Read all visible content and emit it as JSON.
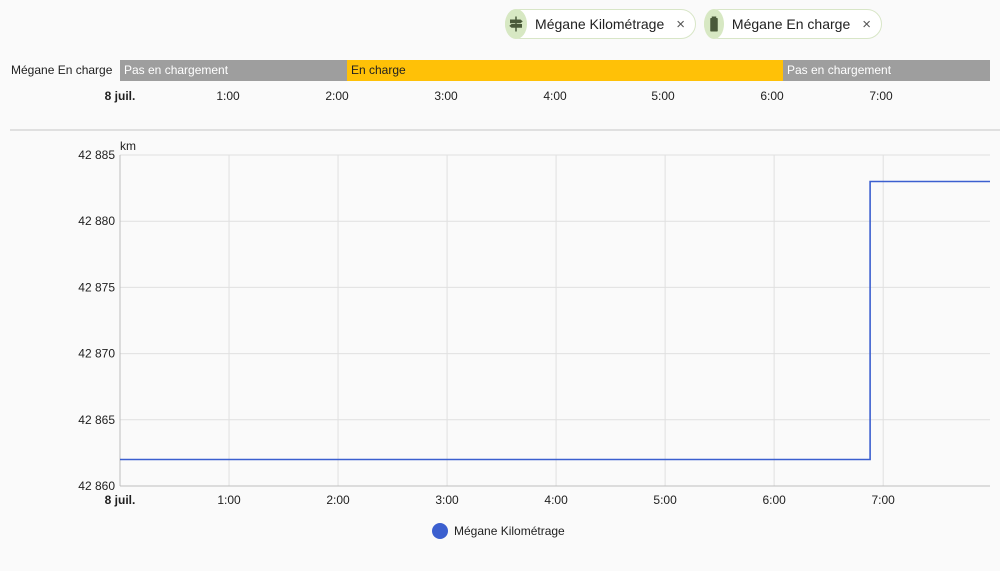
{
  "chips": [
    {
      "label": "Mégane Kilométrage",
      "icon": "road-sign-icon",
      "close": "×"
    },
    {
      "label": "Mégane En charge",
      "icon": "battery-icon",
      "close": "×"
    }
  ],
  "timeline": {
    "entity": "Mégane En charge",
    "segments": [
      {
        "label": "Pas en chargement",
        "state": "off",
        "color": "#9e9e9e"
      },
      {
        "label": "En charge",
        "state": "on",
        "color": "#ffc107"
      },
      {
        "label": "Pas en chargement",
        "state": "off",
        "color": "#9e9e9e"
      }
    ],
    "ticks": [
      "8 juil.",
      "1:00",
      "2:00",
      "3:00",
      "4:00",
      "5:00",
      "6:00",
      "7:00"
    ]
  },
  "chart_data": {
    "type": "line",
    "step": true,
    "ylabel": "km",
    "ylim": [
      42860,
      42885
    ],
    "yticks": [
      "42 885",
      "42 880",
      "42 875",
      "42 870",
      "42 865",
      "42 860"
    ],
    "ytick_values": [
      42885,
      42880,
      42875,
      42870,
      42865,
      42860
    ],
    "xticks": [
      "8 juil.",
      "1:00",
      "2:00",
      "3:00",
      "4:00",
      "5:00",
      "6:00",
      "7:00"
    ],
    "xtick_hours": [
      0,
      1,
      2,
      3,
      4,
      5,
      6,
      7
    ],
    "xlim_hours": [
      0,
      7.98
    ],
    "grid": true,
    "series": [
      {
        "name": "Mégane Kilométrage",
        "color": "#3b5fcf",
        "points": [
          {
            "hour": 0,
            "value": 42862
          },
          {
            "hour": 6.88,
            "value": 42862
          },
          {
            "hour": 6.88,
            "value": 42883
          },
          {
            "hour": 7.98,
            "value": 42883
          }
        ]
      }
    ]
  },
  "legend": {
    "label": "Mégane Kilométrage",
    "color": "#3b5fcf"
  }
}
